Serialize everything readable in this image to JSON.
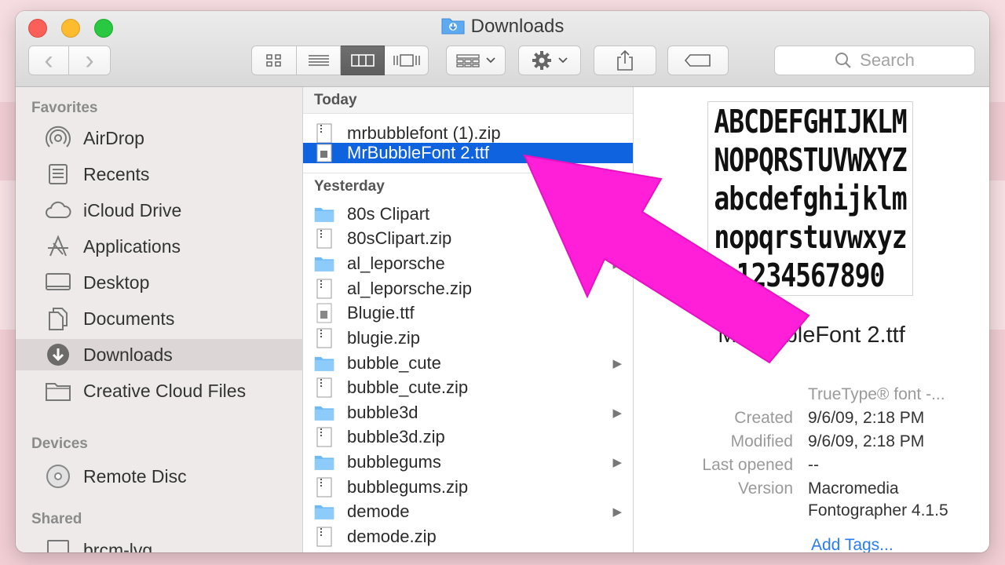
{
  "window": {
    "title": "Downloads"
  },
  "toolbar": {
    "back": "‹",
    "forward": "›",
    "search_placeholder": "Search"
  },
  "sidebar": {
    "favorites_label": "Favorites",
    "favorites": [
      {
        "label": "AirDrop",
        "icon": "airdrop-icon"
      },
      {
        "label": "Recents",
        "icon": "recents-icon"
      },
      {
        "label": "iCloud Drive",
        "icon": "cloud-icon"
      },
      {
        "label": "Applications",
        "icon": "applications-icon"
      },
      {
        "label": "Desktop",
        "icon": "desktop-icon"
      },
      {
        "label": "Documents",
        "icon": "documents-icon"
      },
      {
        "label": "Downloads",
        "icon": "downloads-icon",
        "selected": true
      },
      {
        "label": "Creative Cloud Files",
        "icon": "folder-icon"
      }
    ],
    "devices_label": "Devices",
    "devices": [
      {
        "label": "Remote Disc",
        "icon": "disc-icon"
      }
    ],
    "shared_label": "Shared",
    "shared": [
      {
        "label": "brcm-lvg",
        "icon": "computer-icon"
      }
    ]
  },
  "files": {
    "today_label": "Today",
    "today": [
      {
        "name": "mrbubblefont (1).zip",
        "kind": "zip"
      },
      {
        "name": "MrBubbleFont 2.ttf",
        "kind": "font",
        "selected": true
      }
    ],
    "yesterday_label": "Yesterday",
    "yesterday": [
      {
        "name": "80s Clipart",
        "kind": "folder",
        "has_children": false
      },
      {
        "name": "80sClipart.zip",
        "kind": "zip"
      },
      {
        "name": "al_leporsche",
        "kind": "folder",
        "has_children": true
      },
      {
        "name": "al_leporsche.zip",
        "kind": "zip"
      },
      {
        "name": "Blugie.ttf",
        "kind": "font"
      },
      {
        "name": "blugie.zip",
        "kind": "zip"
      },
      {
        "name": "bubble_cute",
        "kind": "folder",
        "has_children": true
      },
      {
        "name": "bubble_cute.zip",
        "kind": "zip"
      },
      {
        "name": "bubble3d",
        "kind": "folder",
        "has_children": true
      },
      {
        "name": "bubble3d.zip",
        "kind": "zip"
      },
      {
        "name": "bubblegums",
        "kind": "folder",
        "has_children": true
      },
      {
        "name": "bubblegums.zip",
        "kind": "zip"
      },
      {
        "name": "demode",
        "kind": "folder",
        "has_children": true
      },
      {
        "name": "demode.zip",
        "kind": "zip"
      }
    ]
  },
  "preview": {
    "sample_lines": [
      "ABCDEFGHIJKLM",
      "NOPQRSTUVWXYZ",
      "abcdefghijklm",
      "nopqrstuvwxyz",
      "1234567890"
    ],
    "file_name": "MrBubbleFont 2.ttf",
    "kind": "TrueType® font -...",
    "meta": [
      {
        "key": "Created",
        "value": "9/6/09, 2:18 PM"
      },
      {
        "key": "Modified",
        "value": "9/6/09, 2:18 PM"
      },
      {
        "key": "Last opened",
        "value": "--"
      },
      {
        "key": "Version",
        "value": "Macromedia"
      },
      {
        "key": "",
        "value": "Fontographer 4.1.5"
      }
    ],
    "add_tags": "Add Tags..."
  },
  "colors": {
    "selection": "#1063de",
    "annotation_arrow": "#ff1fd8",
    "link": "#2a7cf0"
  }
}
